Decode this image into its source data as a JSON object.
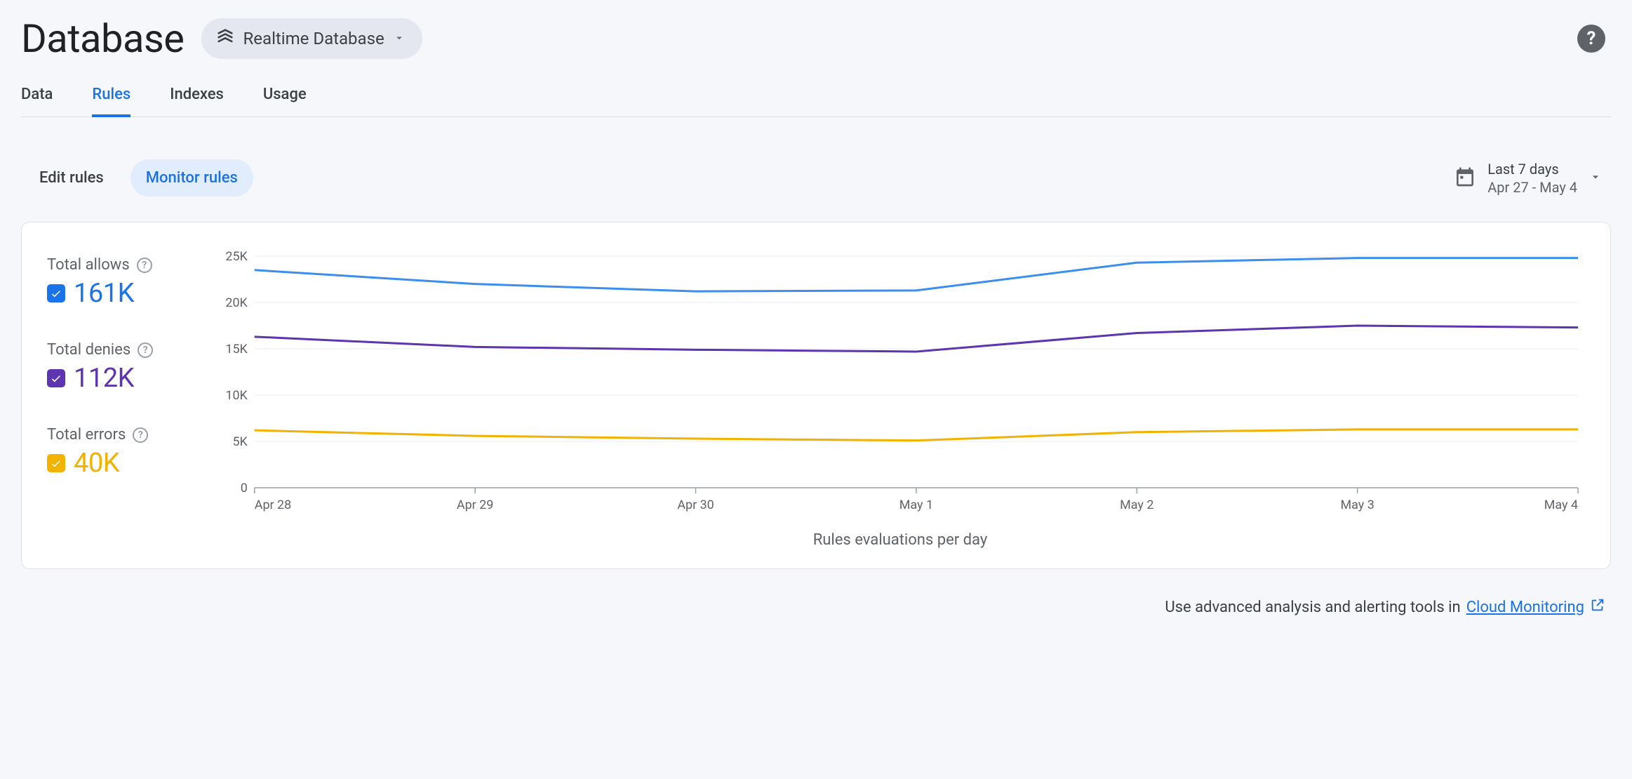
{
  "header": {
    "title": "Database",
    "db_selector_label": "Realtime Database"
  },
  "nav_tabs": {
    "data": "Data",
    "rules": "Rules",
    "indexes": "Indexes",
    "usage": "Usage",
    "active": "rules"
  },
  "subtabs": {
    "edit": "Edit rules",
    "monitor": "Monitor rules",
    "active": "monitor"
  },
  "date_picker": {
    "line1": "Last 7 days",
    "line2": "Apr 27 - May 4"
  },
  "metrics": {
    "allows": {
      "label": "Total allows",
      "value": "161K",
      "color": "#1a73e8"
    },
    "denies": {
      "label": "Total denies",
      "value": "112K",
      "color": "#5e35b1"
    },
    "errors": {
      "label": "Total errors",
      "value": "40K",
      "color": "#f2b200"
    }
  },
  "chart_data": {
    "type": "line",
    "title": "",
    "xlabel": "Rules evaluations per day",
    "ylabel": "",
    "ylim": [
      0,
      25000
    ],
    "y_ticks": [
      0,
      5000,
      10000,
      15000,
      20000,
      25000
    ],
    "y_tick_labels": [
      "0",
      "5K",
      "10K",
      "15K",
      "20K",
      "25K"
    ],
    "categories": [
      "Apr 28",
      "Apr 29",
      "Apr 30",
      "May 1",
      "May 2",
      "May 3",
      "May 4"
    ],
    "series": [
      {
        "name": "Total allows",
        "color": "#3b8ef0",
        "values": [
          23500,
          22000,
          21200,
          21300,
          24300,
          24800,
          24800
        ]
      },
      {
        "name": "Total denies",
        "color": "#5e35b1",
        "values": [
          16300,
          15200,
          14900,
          14700,
          16700,
          17500,
          17300
        ]
      },
      {
        "name": "Total errors",
        "color": "#f2b200",
        "values": [
          6200,
          5600,
          5300,
          5100,
          6000,
          6300,
          6300
        ]
      }
    ]
  },
  "footer": {
    "text_prefix": "Use advanced analysis and alerting tools in ",
    "link_text": "Cloud Monitoring"
  }
}
